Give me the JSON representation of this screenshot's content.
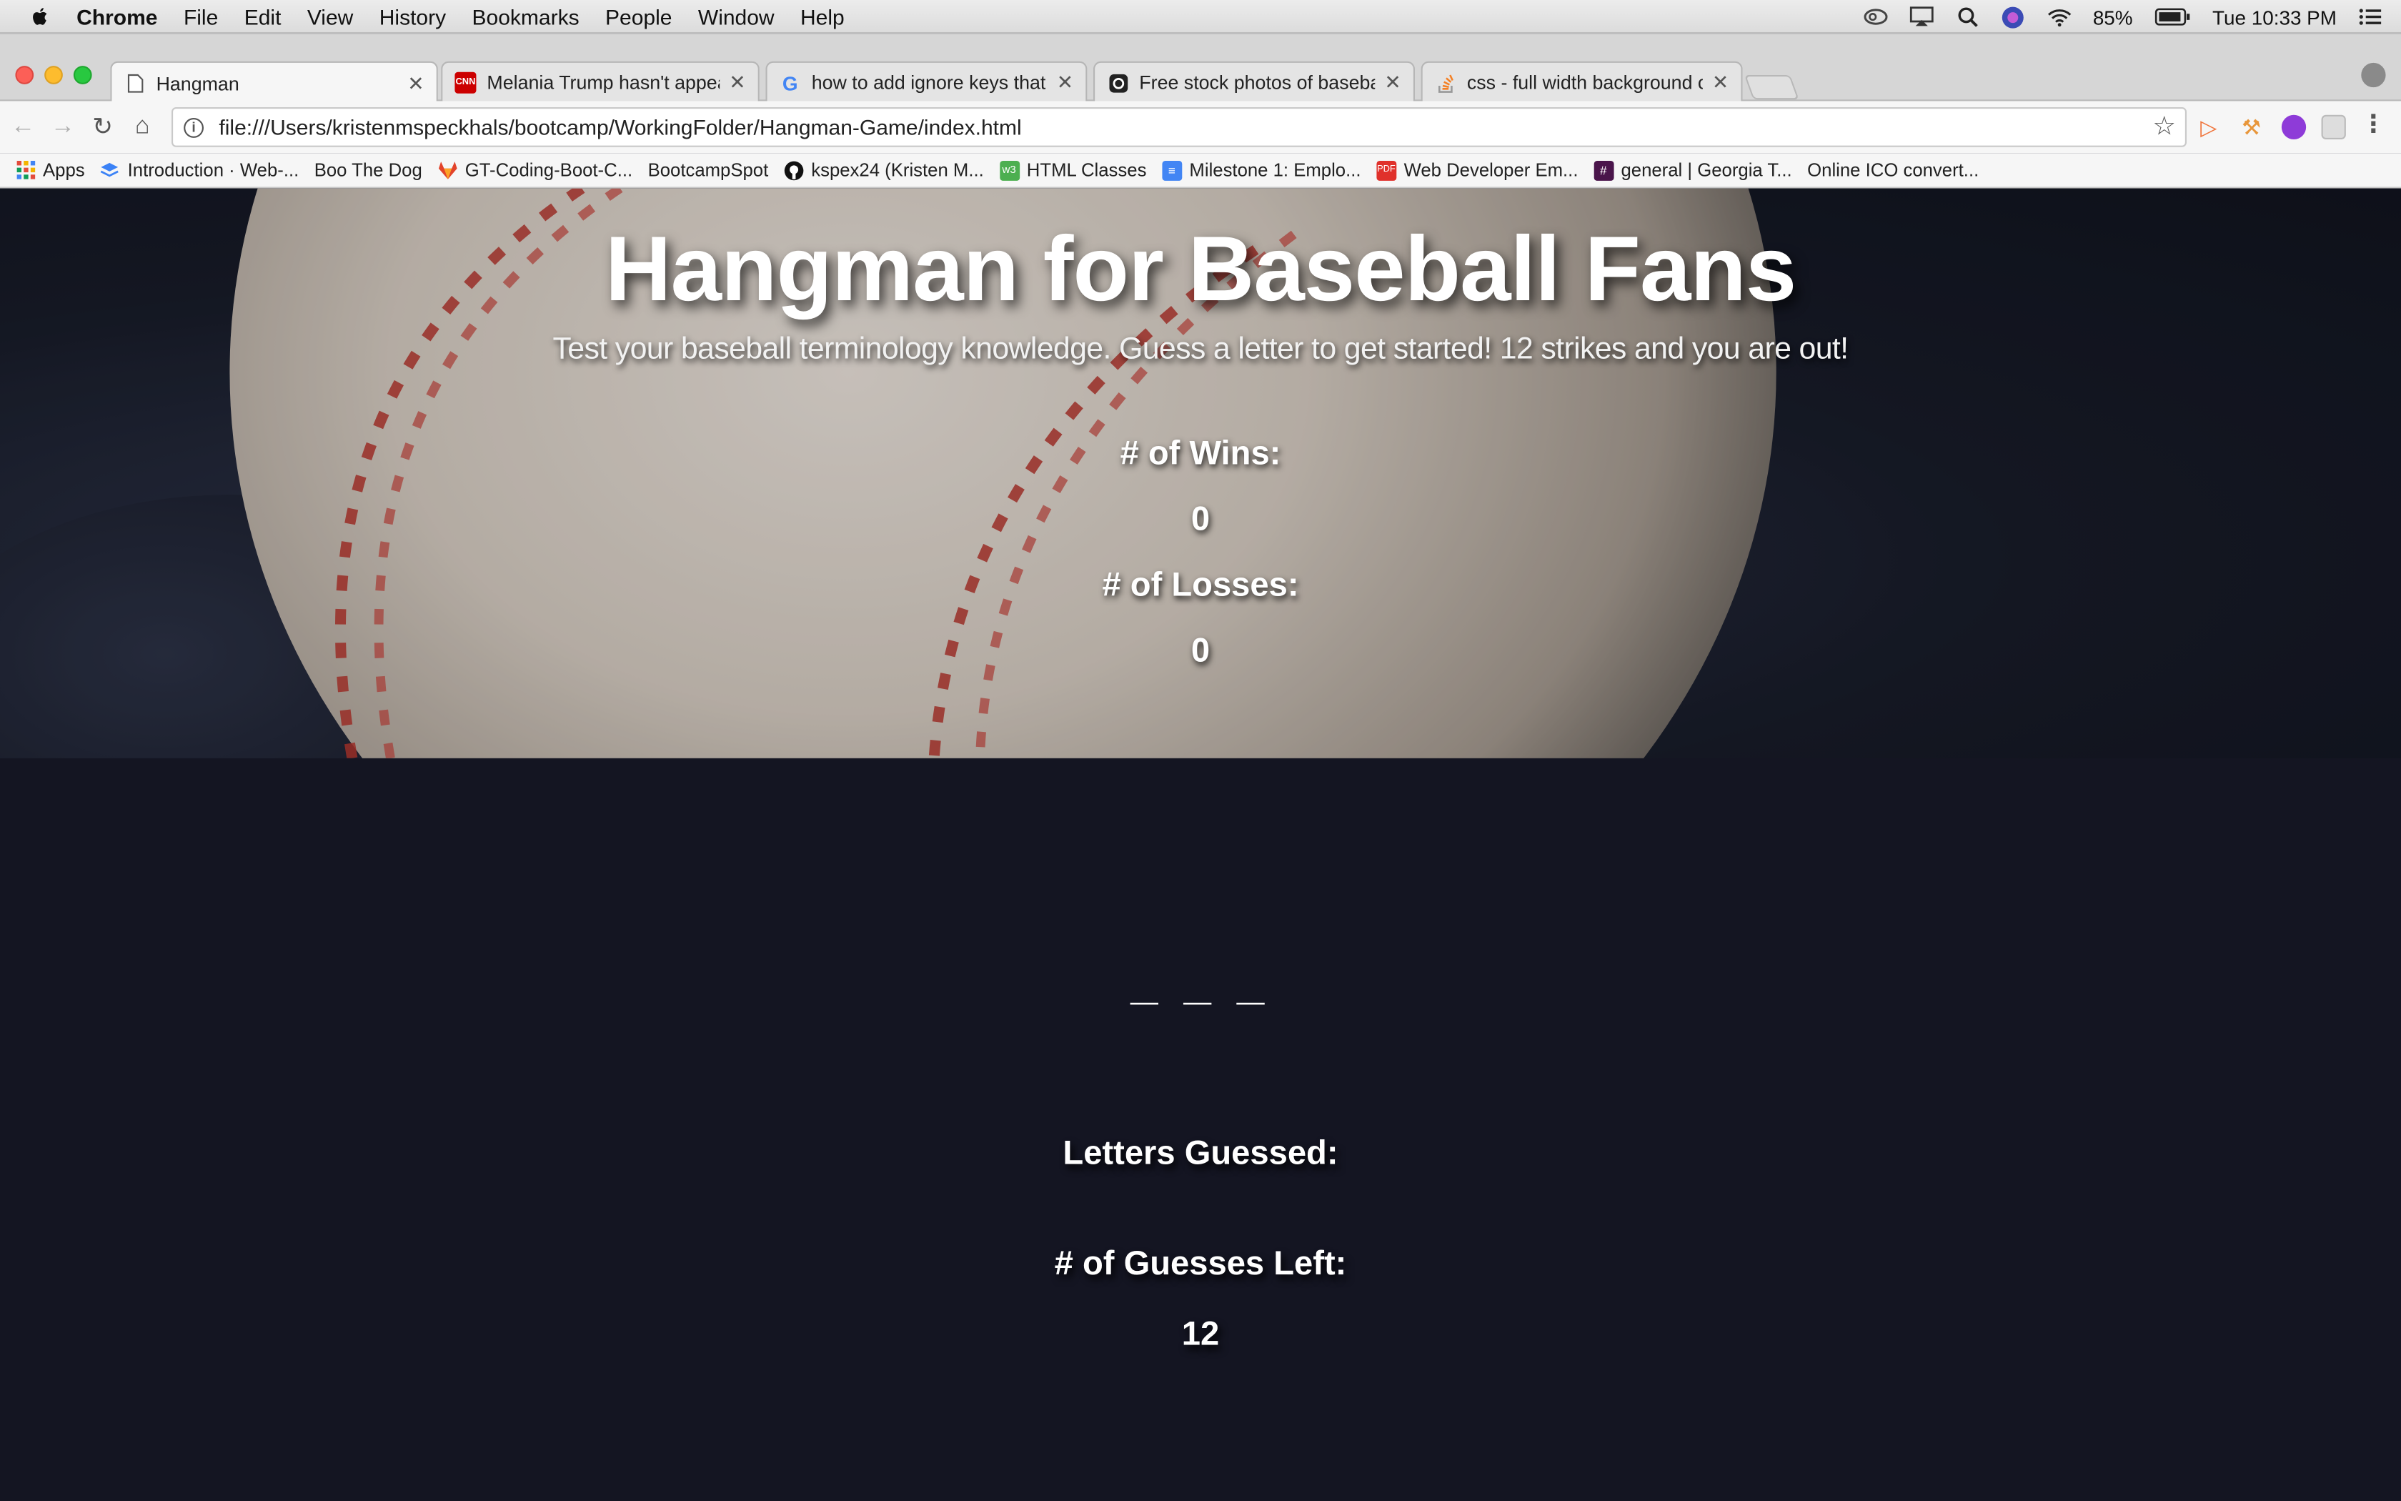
{
  "menubar": {
    "app": "Chrome",
    "items": [
      "File",
      "Edit",
      "View",
      "History",
      "Bookmarks",
      "People",
      "Window",
      "Help"
    ],
    "battery": "85%",
    "clock": "Tue 10:33 PM"
  },
  "tabs": [
    {
      "title": "Hangman",
      "icon": "page-icon"
    },
    {
      "title": "Melania Trump hasn't appeare",
      "icon": "cnn-icon",
      "icon_text": "CNN"
    },
    {
      "title": "how to add ignore keys that ar",
      "icon": "google-icon",
      "icon_text": "G"
    },
    {
      "title": "Free stock photos of baseball",
      "icon": "camera-icon"
    },
    {
      "title": "css - full width background co",
      "icon": "stackoverflow-icon"
    }
  ],
  "address": {
    "url": "file:///Users/kristenmspeckhals/bootcamp/WorkingFolder/Hangman-Game/index.html"
  },
  "bookmarks": [
    {
      "label": "Apps",
      "icon": "apps-grid-icon"
    },
    {
      "label": "Introduction · Web-...",
      "icon": "layers-icon"
    },
    {
      "label": "Boo The Dog",
      "icon": "page-icon"
    },
    {
      "label": "GT-Coding-Boot-C...",
      "icon": "gitlab-icon"
    },
    {
      "label": "BootcampSpot",
      "icon": "page-icon"
    },
    {
      "label": "kspex24 (Kristen M...",
      "icon": "github-icon"
    },
    {
      "label": "HTML Classes",
      "icon": "w3-icon"
    },
    {
      "label": "Milestone 1: Emplo...",
      "icon": "docs-icon"
    },
    {
      "label": "Web Developer Em...",
      "icon": "pdf-icon",
      "icon_text": "PDF"
    },
    {
      "label": "general | Georgia T...",
      "icon": "slack-icon",
      "icon_text": "#"
    },
    {
      "label": "Online ICO convert...",
      "icon": "page-icon"
    }
  ],
  "game": {
    "title": "Hangman for Baseball Fans",
    "subtitle": "Test your baseball terminology knowledge. Guess a letter to get started! 12 strikes and you are out!",
    "wins_label": "# of Wins:",
    "wins": "0",
    "losses_label": "# of Losses:",
    "losses": "0",
    "word_blanks": "_ _ _",
    "letters_guessed_label": "Letters Guessed:",
    "letters_guessed": "",
    "guesses_left_label": "# of Guesses Left:",
    "guesses_left": "12"
  },
  "colors": {
    "page_bg": "#141522",
    "cnn": "#cc0000",
    "pdf": "#e0312b"
  }
}
